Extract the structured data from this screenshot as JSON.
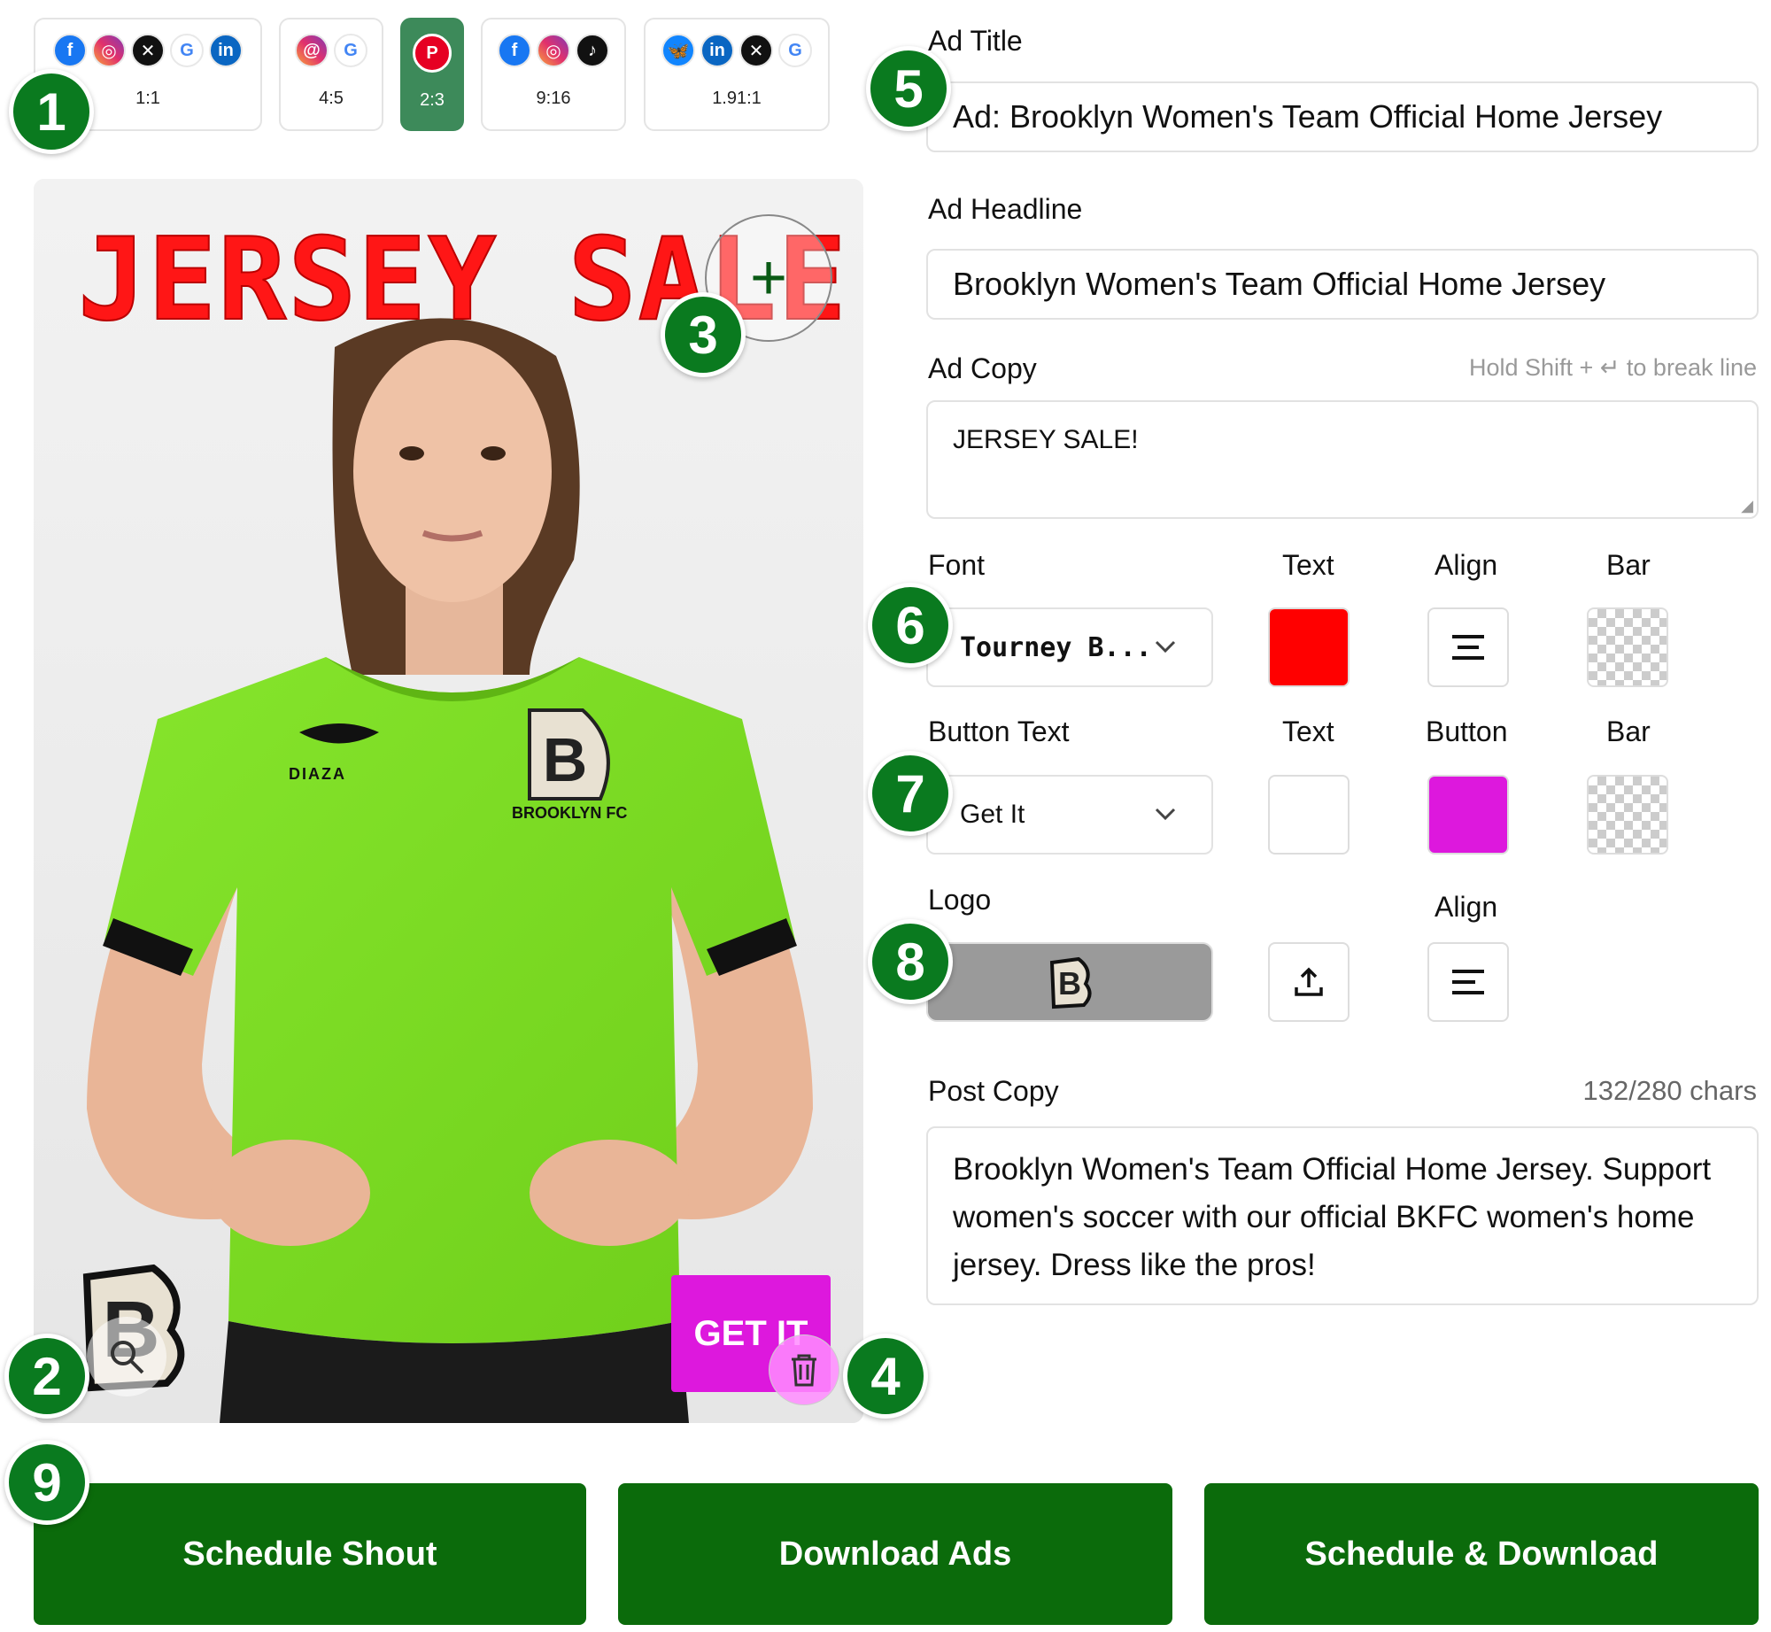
{
  "ratios": [
    {
      "label": "1:1",
      "icons": [
        "facebook-icon",
        "instagram-icon",
        "x-icon",
        "google-icon",
        "linkedin-icon"
      ]
    },
    {
      "label": "4:5",
      "icons": [
        "threads-icon",
        "google-icon"
      ]
    },
    {
      "label": "2:3",
      "icons": [
        "pinterest-icon"
      ],
      "active": true
    },
    {
      "label": "9:16",
      "icons": [
        "facebook-icon",
        "instagram-icon",
        "tiktok-icon"
      ]
    },
    {
      "label": "1.91:1",
      "icons": [
        "bluesky-icon",
        "linkedin-icon",
        "x-icon",
        "google-icon"
      ]
    }
  ],
  "badges": [
    "1",
    "2",
    "3",
    "4",
    "5",
    "6",
    "7",
    "8",
    "9"
  ],
  "preview": {
    "headline": "JERSEY SALE!",
    "button_text": "GET IT",
    "jersey_brand": "DIAZA",
    "jersey_club": "BROOKLYN FC"
  },
  "form": {
    "ad_title_label": "Ad Title",
    "ad_title_value": "Ad: Brooklyn Women's Team Official Home Jersey",
    "ad_headline_label": "Ad Headline",
    "ad_headline_value": "Brooklyn Women's Team Official Home Jersey",
    "ad_copy_label": "Ad Copy",
    "ad_copy_hint": "Hold Shift + ↵ to break line",
    "ad_copy_value": "JERSEY SALE!",
    "font_label": "Font",
    "text_label": "Text",
    "align_label": "Align",
    "bar_label": "Bar",
    "font_value": "Tourney B...",
    "button_text_label": "Button Text",
    "button_label": "Button",
    "button_text_value": "Get It",
    "logo_label": "Logo",
    "logo_align_label": "Align",
    "post_copy_label": "Post Copy",
    "post_copy_count": "132/280 chars",
    "post_copy_value": "Brooklyn Women's Team Official Home Jersey. Support women's soccer with our official BKFC women's home jersey. Dress like the pros!"
  },
  "colors": {
    "text_color": "#ff0000",
    "button_text_color": "#ffffff",
    "button_color": "#dd18dd",
    "accent_green": "#0b6b0b"
  },
  "actions": {
    "schedule_shout": "Schedule Shout",
    "download_ads": "Download Ads",
    "schedule_download": "Schedule & Download"
  }
}
